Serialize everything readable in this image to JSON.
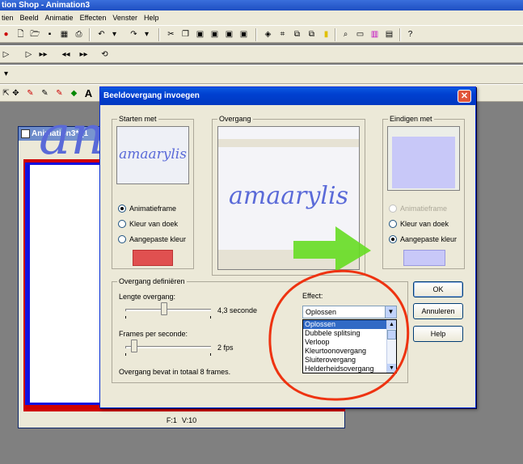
{
  "app": {
    "title": "tion Shop - Animation3",
    "menu": [
      "tien",
      "Beeld",
      "Animatie",
      "Effecten",
      "Venster",
      "Help"
    ]
  },
  "anim_window": {
    "title": "Animation3* [1",
    "canvas_text": "an",
    "status": {
      "frame": "F:1",
      "view": "V:10"
    }
  },
  "dialog": {
    "title": "Beeldovergang invoegen",
    "close_glyph": "✕",
    "start": {
      "label": "Starten met",
      "preview_text": "amaarylis",
      "options": [
        "Animatieframe",
        "Kleur van doek",
        "Aangepaste kleur"
      ],
      "selected": 0,
      "custom_color": "#e05050"
    },
    "transition": {
      "label": "Overgang",
      "preview_text": "amaarylis"
    },
    "end": {
      "label": "Eindigen met",
      "options": [
        "Animatieframe",
        "Kleur van doek",
        "Aangepaste kleur"
      ],
      "selected": 2,
      "disabled": [
        0
      ],
      "custom_color": "#c8c8f8"
    },
    "define": {
      "label": "Overgang definiëren",
      "length_label": "Lengte overgang:",
      "length_value": "4,3 seconde",
      "length_fraction": 0.45,
      "fps_label": "Frames per seconde:",
      "fps_value": "2 fps",
      "fps_fraction": 0.1,
      "total_text": "Overgang bevat in totaal 8 frames."
    },
    "effect": {
      "label": "Effect:",
      "selected": "Oplossen",
      "options": [
        "Oplossen",
        "Dubbele splitsing",
        "Verloop",
        "Kleurtoonovergang",
        "Sluiterovergang",
        "Helderheidsovergang"
      ]
    },
    "buttons": {
      "ok": "OK",
      "cancel": "Annuleren",
      "help": "Help"
    }
  },
  "colors": {
    "accent": "#0a58e0",
    "annotation_arrow": "#66dd22",
    "annotation_ellipse": "#ee3311",
    "text_blue": "#5a6ad8"
  }
}
